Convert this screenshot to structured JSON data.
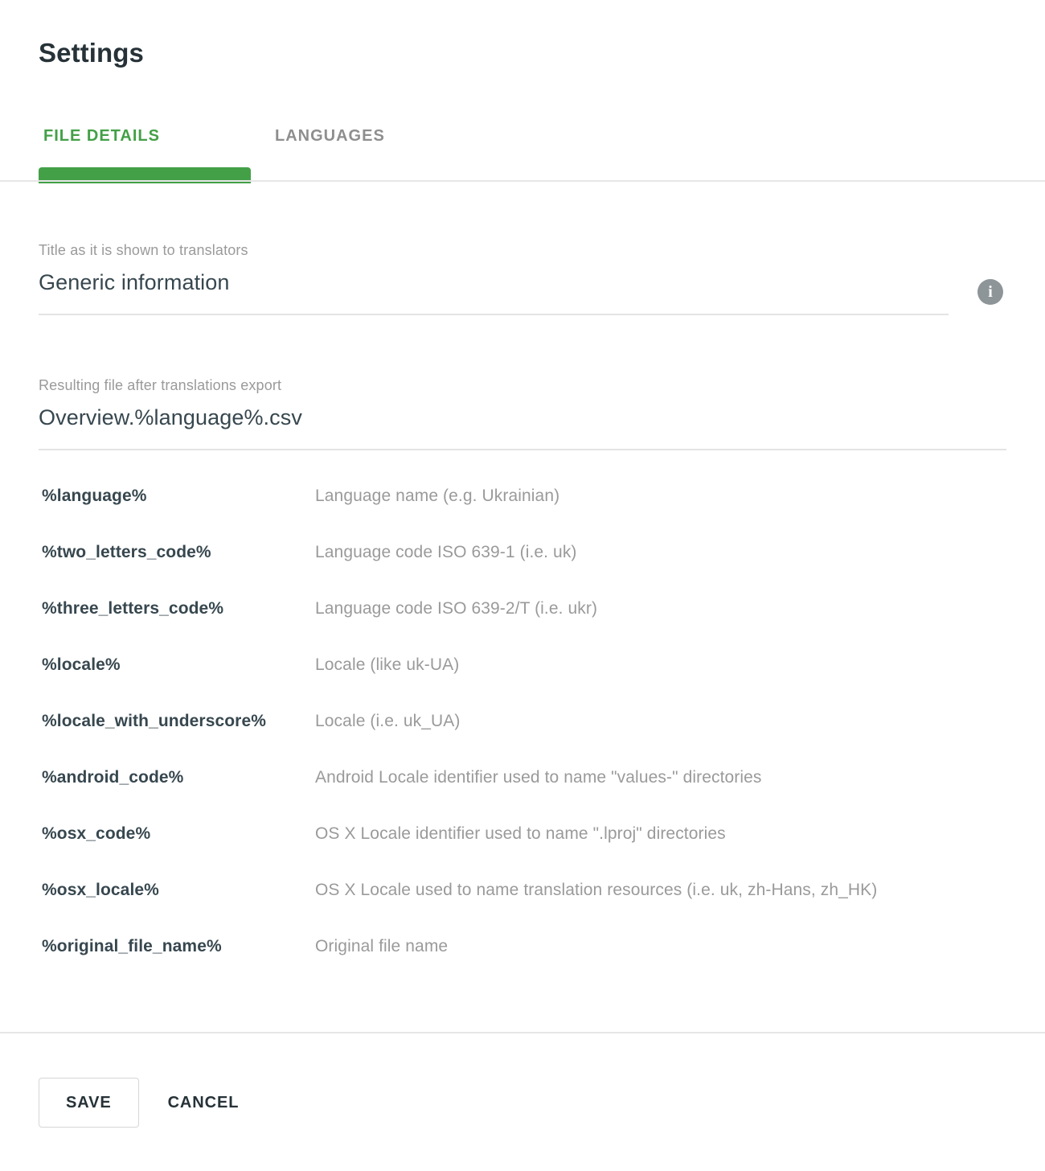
{
  "page": {
    "title": "Settings"
  },
  "tabs": {
    "items": [
      {
        "label": "FILE DETAILS",
        "active": true
      },
      {
        "label": "LANGUAGES",
        "active": false
      }
    ],
    "active_color": "#43a047",
    "inactive_color": "#8e8e8e"
  },
  "fields": {
    "title": {
      "label": "Title as it is shown to translators",
      "value": "Generic information",
      "placeholder": "Title as it is shown to translators"
    },
    "filename": {
      "label": "Resulting file after translations export",
      "value": "Overview.%language%.csv",
      "placeholder": "Resulting file after translations export"
    },
    "info_icon": "info-icon",
    "info_icon_glyph": "i"
  },
  "placeholders": {
    "rows": [
      {
        "key": "%language%",
        "description": "Language name (e.g. Ukrainian)"
      },
      {
        "key": "%two_letters_code%",
        "description": "Language code ISO 639-1 (i.e. uk)"
      },
      {
        "key": "%three_letters_code%",
        "description": "Language code ISO 639-2/T (i.e. ukr)"
      },
      {
        "key": "%locale%",
        "description": "Locale (like uk-UA)"
      },
      {
        "key": "%locale_with_underscore%",
        "description": "Locale (i.e. uk_UA)"
      },
      {
        "key": "%android_code%",
        "description": "Android Locale identifier used to name \"values-\" directories"
      },
      {
        "key": "%osx_code%",
        "description": "OS X Locale identifier used to name \".lproj\" directories"
      },
      {
        "key": "%osx_locale%",
        "description": "OS X Locale used to name translation resources (i.e. uk, zh-Hans, zh_HK)"
      },
      {
        "key": "%original_file_name%",
        "description": "Original file name"
      }
    ]
  },
  "footer": {
    "save_label": "SAVE",
    "cancel_label": "CANCEL"
  }
}
